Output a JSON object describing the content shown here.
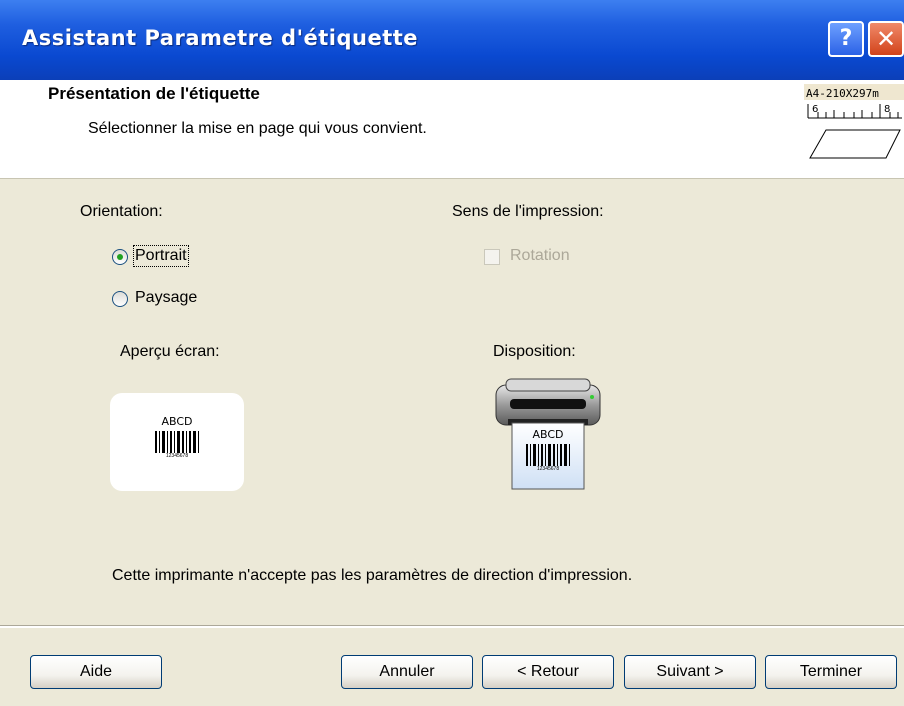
{
  "window": {
    "title": "Assistant Parametre d'étiquette",
    "help_glyph": "?",
    "close_glyph": "✕"
  },
  "header": {
    "title": "Présentation de l'étiquette",
    "subtitle": "Sélectionner la mise en page qui vous convient.",
    "paper_size": "A4-210X297m",
    "ruler_marks": [
      "6",
      "8"
    ]
  },
  "orientation": {
    "label": "Orientation:",
    "options": [
      {
        "label": "Portrait",
        "selected": true
      },
      {
        "label": "Paysage",
        "selected": false
      }
    ]
  },
  "print_direction": {
    "label": "Sens de l'impression:",
    "rotation_label": "Rotation",
    "rotation_checked": false,
    "rotation_enabled": false
  },
  "screen_preview": {
    "label": "Aperçu écran:",
    "label_text": "ABCD",
    "barcode_number": "12345678"
  },
  "layout_preview": {
    "label": "Disposition:",
    "label_text": "ABCD",
    "barcode_number": "12345678"
  },
  "message": "Cette imprimante n'accepte pas les paramètres de direction d'impression.",
  "footer": {
    "help": "Aide",
    "cancel": "Annuler",
    "back": "< Retour",
    "next": "Suivant >",
    "finish": "Terminer"
  }
}
